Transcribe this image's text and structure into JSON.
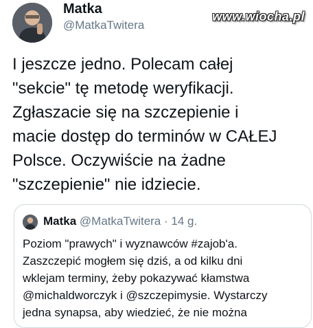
{
  "tweet": {
    "name": "Matka",
    "handle": "@MatkaTwitera",
    "text_lines": [
      "I jeszcze jedno. Polecam całej",
      "\"sekcie\" tę metodę weryfikacji.",
      "Zgłaszacie się na szczepienie i",
      "macie dostęp do terminów w CAŁEJ",
      "Polsce. Oczywiście na żadne",
      "\"szczepienie\" nie idziecie."
    ]
  },
  "quoted": {
    "name": "Matka",
    "handle": "@MatkaTwitera",
    "separator": "·",
    "time": "14 g.",
    "text_lines": [
      "Poziom \"prawych\" i wyznawców #zajob'a.",
      "Zaszczepić mogłem się dziś, a od kilku dni",
      "wklejam terminy, żeby pokazywać kłamstwa",
      "@michaldworczyk i @szczepimysie. Wystarczy",
      "jedna synapsa, aby wiedzieć, że nie można"
    ]
  },
  "watermark": "www.wiocha.pl",
  "colors": {
    "text": "#0f1419",
    "secondary": "#657786",
    "border": "#cfd9de"
  },
  "icons": {
    "avatar": "user-avatar-photo"
  }
}
